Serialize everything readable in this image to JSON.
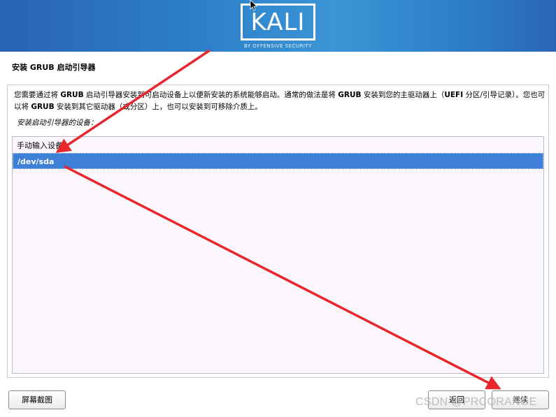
{
  "header": {
    "logo_text": "KALI",
    "logo_subtitle": "BY OFFENSIVE SECURITY"
  },
  "page": {
    "title": "安装 GRUB 启动引导器",
    "description_parts": [
      "您需要通过将 ",
      "GRUB",
      " 启动引导器安装到可启动设备上以便新安装的系统能够启动。通常的做法是将 ",
      "GRUB",
      " 安装到您的主驱动器上（",
      "UEFI",
      " 分区/引导记录）。您也可以将 ",
      "GRUB",
      " 安装到其它驱动器（或分区）上，也可以安装到可移除介质上。"
    ],
    "prompt": "安装启动引导器的设备："
  },
  "device_list": {
    "items": [
      {
        "label": "手动输入设备",
        "selected": false
      },
      {
        "label": "/dev/sda",
        "selected": true
      }
    ]
  },
  "buttons": {
    "screenshot": "屏幕截图",
    "back": "返回",
    "continue": "继续"
  },
  "watermark": "CSDN @PRCORANGE",
  "colors": {
    "banner": "#2d7fc9",
    "selection": "#3e7fd8",
    "annotation_arrow": "#e8262b"
  },
  "icons": {
    "mouse_cursor": "arrow-cursor-icon",
    "annotation": "red-arrow-icon"
  }
}
